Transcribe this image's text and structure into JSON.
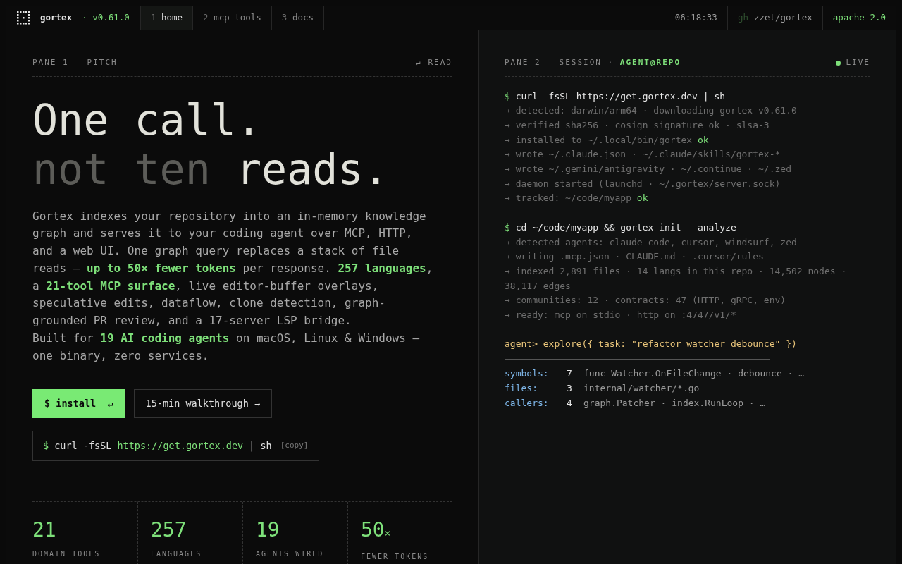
{
  "topbar": {
    "brand": "gortex",
    "version": "· v0.61.0",
    "tabs": [
      {
        "number": "1",
        "label": "home",
        "selected": true
      },
      {
        "number": "2",
        "label": "mcp-tools",
        "selected": false
      },
      {
        "number": "3",
        "label": "docs",
        "selected": false
      }
    ],
    "clock": "06:18:33",
    "repo_prefix": "gh",
    "repo": "zzet/gortex",
    "license": "apache 2.0"
  },
  "pane_left": {
    "label": "PANE 1 — PITCH",
    "hint": "↵ READ",
    "headline": [
      [
        {
          "text": "One call.",
          "dim": false
        }
      ],
      [
        {
          "text": "not ten",
          "dim": true
        },
        {
          "text": " reads.",
          "dim": false
        }
      ]
    ],
    "paragraphs": [
      [
        {
          "text": "Gortex indexes your repository into an in-memory knowledge graph and serves it to your coding agent over MCP, HTTP, and a web UI. One graph query replaces a stack of file reads — ",
          "highlight": false
        },
        {
          "text": "up to 50× fewer tokens",
          "highlight": true
        },
        {
          "text": " per response. ",
          "highlight": false
        },
        {
          "text": "257 languages",
          "highlight": true
        },
        {
          "text": ", a ",
          "highlight": false
        },
        {
          "text": "21-tool MCP surface",
          "highlight": true
        },
        {
          "text": ", live editor-buffer overlays, speculative edits, dataflow, clone detection, graph-grounded PR review, and a 17-server LSP bridge.",
          "highlight": false
        }
      ],
      [
        {
          "text": "Built for ",
          "highlight": false
        },
        {
          "text": "19 AI coding agents",
          "highlight": true
        },
        {
          "text": " on macOS, Linux & Windows — one binary, zero services.",
          "highlight": false
        }
      ]
    ],
    "install_button": "$ install  ↵",
    "walkthrough_button": "15-min walkthrough →",
    "snippet": {
      "prompt": "$",
      "command": "curl -fsSL",
      "url": "https://get.gortex.dev",
      "pipe": "| sh",
      "copy": "[copy]"
    },
    "stats": [
      {
        "value": "21",
        "label": "DOMAIN TOOLS"
      },
      {
        "value": "257",
        "label": "LANGUAGES"
      },
      {
        "value": "19",
        "label": "AGENTS WIRED"
      },
      {
        "value": "50",
        "suffix": "×",
        "label": "FEWER TOKENS"
      }
    ]
  },
  "pane_right": {
    "label": "PANE 2 — SESSION · ",
    "label_accent": "AGENT@REPO",
    "status": "LIVE",
    "live": true,
    "lines": [
      {
        "kind": "command",
        "prompt": "$",
        "text": "curl -fsSL https://get.gortex.dev | sh"
      },
      {
        "kind": "output",
        "text": "→ detected: darwin/arm64 · downloading gortex v0.61.0"
      },
      {
        "kind": "output",
        "text": "→ verified sha256 · cosign signature ok · slsa-3"
      },
      {
        "kind": "output",
        "text": "→ installed to ~/.local/bin/gortex",
        "ok": "ok"
      },
      {
        "kind": "output",
        "text": "→ wrote ~/.claude.json · ~/.claude/skills/gortex-*"
      },
      {
        "kind": "output",
        "text": "→ wrote ~/.gemini/antigravity · ~/.continue · ~/.zed"
      },
      {
        "kind": "output",
        "text": "→ daemon started (launchd · ~/.gortex/server.sock)"
      },
      {
        "kind": "output",
        "text": "→ tracked: ~/code/myapp",
        "ok": "ok"
      },
      {
        "kind": "blank"
      },
      {
        "kind": "command",
        "prompt": "$",
        "text": "cd ~/code/myapp && gortex init --analyze"
      },
      {
        "kind": "output",
        "text": "→ detected agents: claude-code, cursor, windsurf, zed"
      },
      {
        "kind": "output",
        "text": "→ writing .mcp.json · CLAUDE.md · .cursor/rules"
      },
      {
        "kind": "output",
        "text": "→ indexed 2,891 files · 14 langs in this repo · 14,502 nodes · 38,117 edges"
      },
      {
        "kind": "output",
        "text": "→ communities: 12 · contracts: 47 (HTTP, gRPC, env)"
      },
      {
        "kind": "output",
        "text": "→ ready: mcp on stdio · http on :4747/v1/*"
      },
      {
        "kind": "blank"
      },
      {
        "kind": "agent",
        "prompt": "agent>",
        "text": "explore({ task: \"refactor watcher debounce\" })"
      },
      {
        "kind": "rule"
      },
      {
        "kind": "result",
        "key": "symbols:",
        "count": "7",
        "text": "func Watcher.OnFileChange · debounce · …"
      },
      {
        "kind": "result",
        "key": "files:",
        "count": "3",
        "text": "internal/watcher/*.go"
      },
      {
        "kind": "result",
        "key": "callers:",
        "count": "4",
        "text": "graph.Patcher · index.RunLoop · …"
      }
    ]
  }
}
